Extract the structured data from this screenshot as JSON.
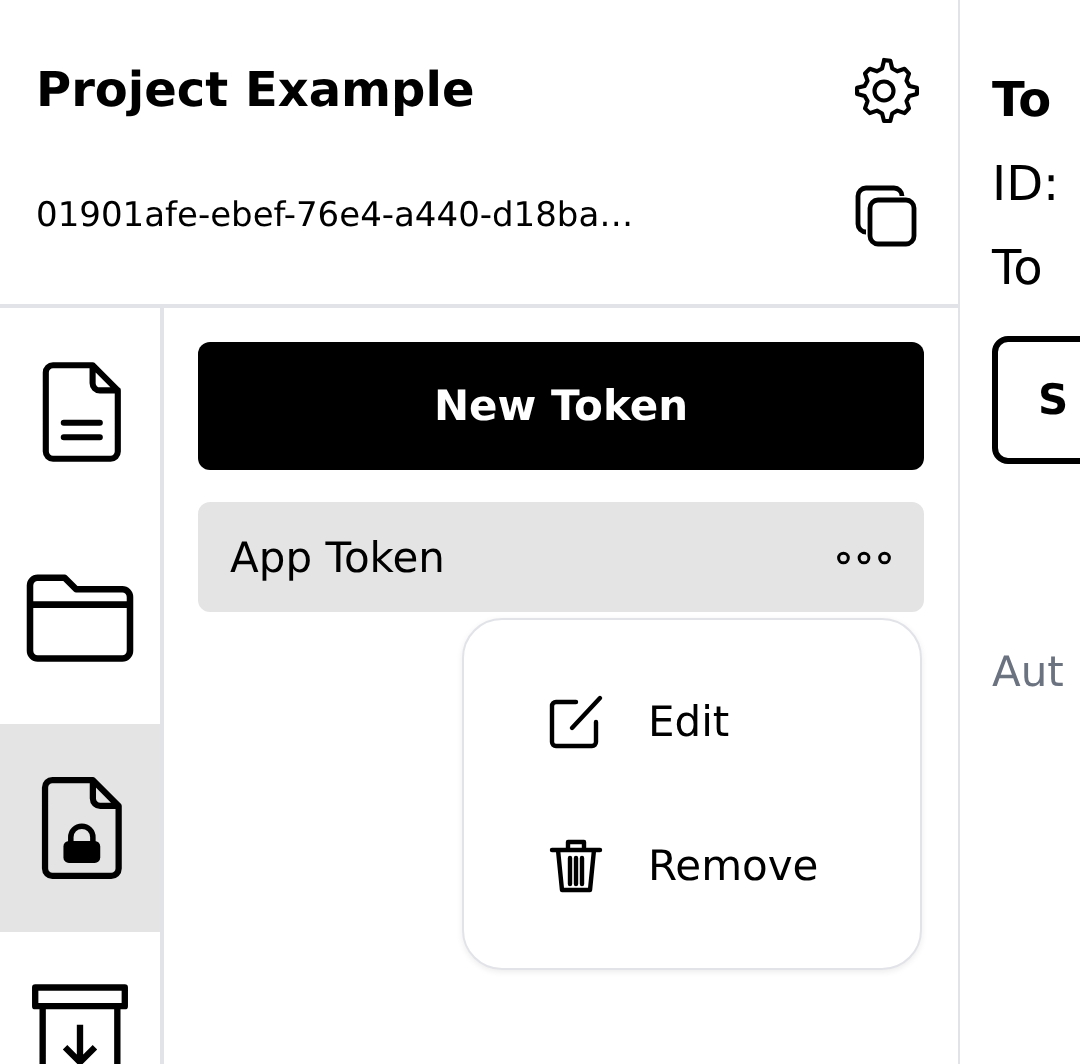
{
  "project": {
    "title": "Project Example",
    "id": "01901afe-ebef-76e4-a440-d18ba…"
  },
  "sidebar": {
    "items": [
      {
        "kind": "document",
        "selected": false
      },
      {
        "kind": "folder",
        "selected": false
      },
      {
        "kind": "locked-document",
        "selected": true
      },
      {
        "kind": "archive",
        "selected": false
      }
    ]
  },
  "new_token_button": "New Token",
  "tokens": [
    {
      "name": "App Token",
      "selected": true
    }
  ],
  "context_menu": {
    "items": [
      {
        "kind": "edit",
        "label": "Edit"
      },
      {
        "kind": "remove",
        "label": "Remove"
      }
    ]
  },
  "detail": {
    "title": "To",
    "id_label": "ID:",
    "token_label": "To",
    "button": "S",
    "auth_label": "Aut"
  }
}
